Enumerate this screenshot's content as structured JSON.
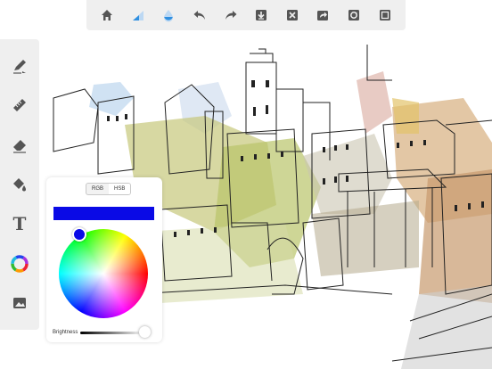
{
  "top_toolbar": {
    "buttons": [
      "home-icon",
      "brush-size-icon",
      "opacity-icon",
      "undo-icon",
      "redo-icon",
      "import-icon",
      "clear-icon",
      "share-icon",
      "record-icon",
      "fullscreen-icon"
    ]
  },
  "left_toolbar": {
    "tools": [
      "pen-icon",
      "ruler-icon",
      "eraser-icon",
      "fill-icon",
      "text-icon",
      "color-wheel-icon",
      "image-icon"
    ],
    "text_tool_glyph": "T"
  },
  "color_picker": {
    "modes": [
      "RGB",
      "HSB"
    ],
    "active_mode": "HSB",
    "current_color": "#0a0ae6",
    "brightness_label": "Brightness",
    "brightness": 1.0
  },
  "colors": {
    "toolbar_bg": "#efefef",
    "icon": "#555555",
    "accent": "#2f8fe0"
  }
}
